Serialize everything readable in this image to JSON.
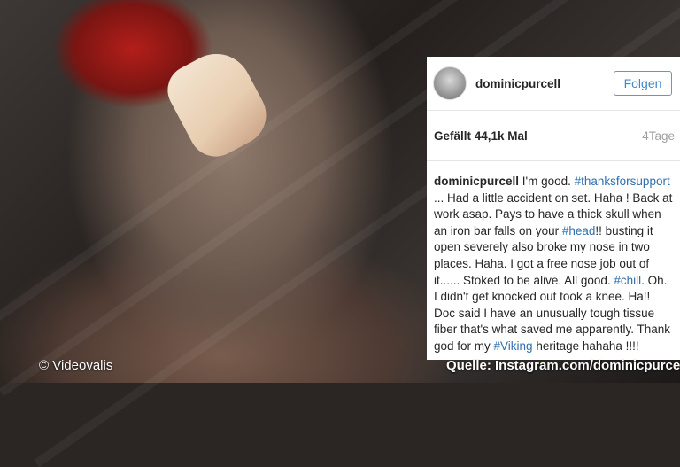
{
  "watermark": "© Videovalis",
  "source": "Quelle: Instagram.com/dominicpurcell",
  "post": {
    "username": "dominicpurcell",
    "follow_label": "Folgen",
    "likes": "Gefällt 44,1k Mal",
    "age": "4Tage",
    "caption": {
      "user": "dominicpurcell",
      "t1": " I'm good. ",
      "tag1": "#thanksforsupport",
      "t2": " ... Had a little accident on set. Haha ! Back at work asap. Pays to have a thick skull when an iron bar falls on your ",
      "tag2": "#head",
      "t3": "!! busting it open severely also broke my nose in two places. Haha. I got a free nose job out of it...... Stoked to be alive. All good. ",
      "tag3": "#chill",
      "t4": ". Oh. I didn't get knocked out took a knee. Ha!! Doc said I have an unusually tough tissue fiber that's what saved me apparently. Thank god for my ",
      "tag4": "#Viking",
      "t5": " heritage hahaha !!!!"
    }
  },
  "colors": {
    "link": "#2f6fad",
    "follow_border": "#5b9ad5",
    "muted": "#a0a0a0"
  }
}
